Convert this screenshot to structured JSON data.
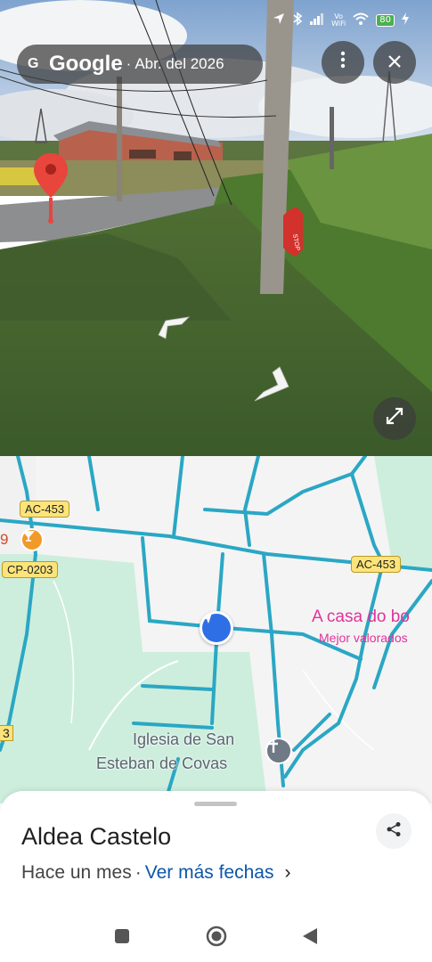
{
  "status_bar": {
    "battery": "80",
    "volte": "Vo\nWiFi",
    "icons": [
      "location-icon",
      "bluetooth-icon",
      "signal-icon",
      "volte-icon",
      "wifi-icon",
      "battery-icon",
      "charging-icon"
    ]
  },
  "street_view": {
    "brand": "Google",
    "separator": "·",
    "date": "Abr. del 2026",
    "stop_sign": "STOP",
    "more_icon": "more-vert-icon",
    "close_icon": "close-icon",
    "expand_icon": "expand-icon"
  },
  "map": {
    "road_labels": [
      "AC-453",
      "CP-0203",
      "AC-453"
    ],
    "edge_numbers": [
      "9",
      "3"
    ],
    "place_name": "A casa do bo",
    "place_tag": "Mejor valorados",
    "church_name_line1": "Iglesia de San",
    "church_name_line2": "Esteban de Covas",
    "colors": {
      "land": "#cdeedd",
      "road": "#2aa7c4",
      "urban": "#f4f4f4",
      "pink_label": "#e0339b",
      "you_are_here": "#2f6fe6"
    }
  },
  "sheet": {
    "title": "Aldea Castelo",
    "time_ago": "Hace un mes",
    "dot": "·",
    "more_dates": "Ver más fechas",
    "chevron": "›",
    "share_icon": "share-icon"
  },
  "system_nav": {
    "buttons": [
      "recents-button",
      "home-button",
      "back-button"
    ]
  }
}
